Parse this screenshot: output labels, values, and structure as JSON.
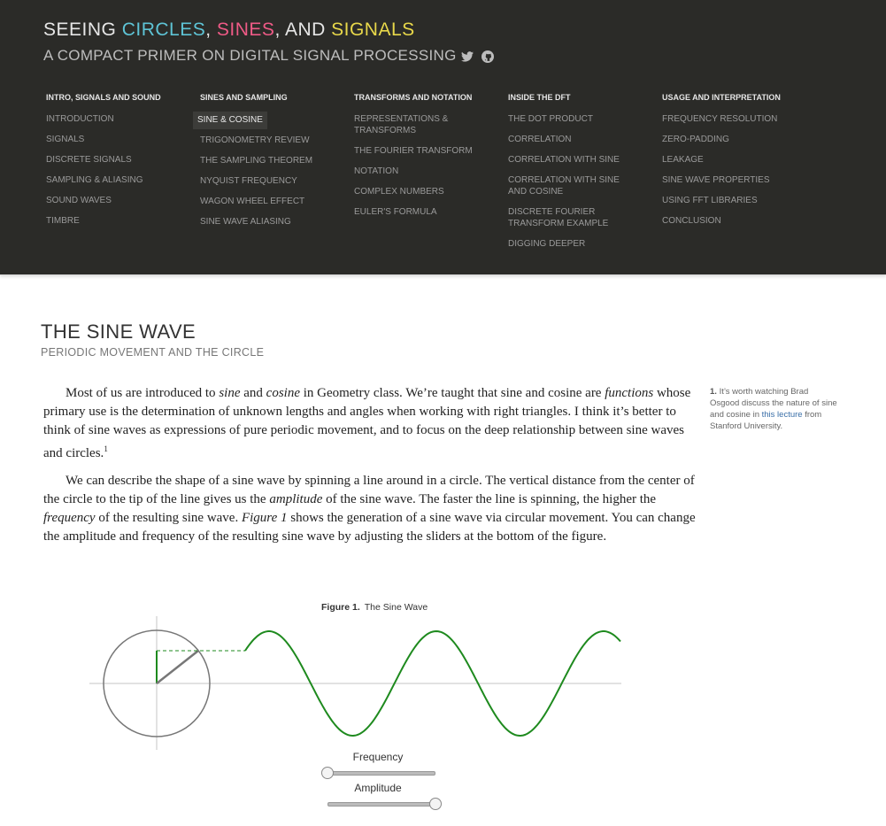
{
  "site": {
    "title_parts": [
      "SEEING ",
      "CIRCLES",
      ", ",
      "SINES",
      ", AND ",
      "SIGNALS"
    ],
    "subtitle": "A COMPACT PRIMER ON DIGITAL SIGNAL PROCESSING",
    "social": [
      "twitter-icon",
      "github-icon"
    ],
    "colors": {
      "circles": "#5ec4d6",
      "sines": "#ee5a86",
      "signals": "#e8d84a",
      "header_bg": "#2b2b28"
    }
  },
  "nav": [
    {
      "heading": "INTRO, SIGNALS AND SOUND",
      "items": [
        "INTRODUCTION",
        "SIGNALS",
        "DISCRETE SIGNALS",
        "SAMPLING & ALIASING",
        "SOUND WAVES",
        "TIMBRE"
      ]
    },
    {
      "heading": "SINES AND SAMPLING",
      "items": [
        "SINE & COSINE",
        "TRIGONOMETRY REVIEW",
        "THE SAMPLING THEOREM",
        "NYQUIST FREQUENCY",
        "WAGON WHEEL EFFECT",
        "SINE WAVE ALIASING"
      ],
      "active": 0
    },
    {
      "heading": "TRANSFORMS AND NOTATION",
      "items": [
        "REPRESENTATIONS & TRANSFORMS",
        "THE FOURIER TRANSFORM",
        "NOTATION",
        "COMPLEX NUMBERS",
        "EULER'S FORMULA"
      ]
    },
    {
      "heading": "INSIDE THE DFT",
      "items": [
        "THE DOT PRODUCT",
        "CORRELATION",
        "CORRELATION WITH SINE",
        "CORRELATION WITH SINE AND COSINE",
        "DISCRETE FOURIER TRANSFORM EXAMPLE",
        "DIGGING DEEPER"
      ]
    },
    {
      "heading": "USAGE AND INTERPRETATION",
      "items": [
        "FREQUENCY RESOLUTION",
        "ZERO-PADDING",
        "LEAKAGE",
        "SINE WAVE PROPERTIES",
        "USING FFT LIBRARIES",
        "CONCLUSION"
      ]
    }
  ],
  "page": {
    "title": "THE SINE WAVE",
    "subtitle": "PERIODIC MOVEMENT AND THE CIRCLE"
  },
  "paragraphs": [
    [
      {
        "t": "Most of us are introduced to "
      },
      {
        "t": "sine",
        "i": true
      },
      {
        "t": " and "
      },
      {
        "t": "cosine",
        "i": true
      },
      {
        "t": " in Geometry class. We’re taught that sine and cosine are "
      },
      {
        "t": "functions",
        "i": true
      },
      {
        "t": " whose primary use is the determination of unknown lengths and angles when working with right triangles. I think it’s better to think of sine waves as expressions of pure periodic movement, and to focus on the deep relationship between sine waves and circles."
      },
      {
        "t": "1",
        "sup": true
      }
    ],
    [
      {
        "t": "We can describe the shape of a sine wave by spinning a line around in a circle. The vertical distance from the center of the circle to the tip of the line gives us the "
      },
      {
        "t": "amplitude",
        "i": true
      },
      {
        "t": " of the sine wave. The faster the line is spinning, the higher the "
      },
      {
        "t": "frequency",
        "i": true
      },
      {
        "t": " of the resulting sine wave. "
      },
      {
        "t": "Figure 1",
        "i": true
      },
      {
        "t": " shows the generation of a sine wave via circular movement. You can change the amplitude and frequency of the resulting sine wave by adjusting the sliders at the bottom of the figure."
      }
    ]
  ],
  "sidenote": {
    "number": "1.",
    "text_before": "It’s worth watching Brad Osgood discuss the nature of sine and cosine in ",
    "link": "this lecture",
    "text_after": " from Stanford University."
  },
  "figure": {
    "label": "Figure 1.",
    "caption": "The Sine Wave",
    "wave_color": "#1e8a1e",
    "sliders": [
      {
        "label": "Frequency",
        "value": 0.0
      },
      {
        "label": "Amplitude",
        "value": 1.0
      }
    ]
  }
}
